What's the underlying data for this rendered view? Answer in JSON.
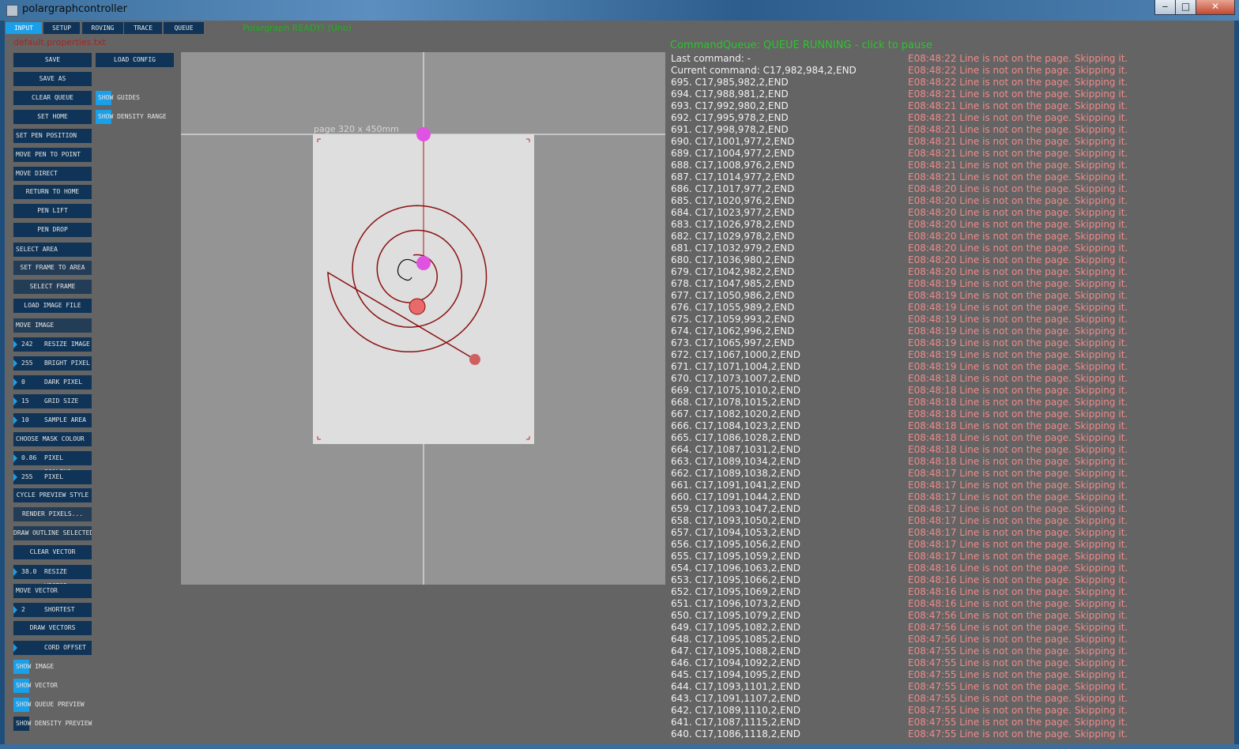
{
  "window": {
    "title": "polargraphcontroller",
    "controls": {
      "minimize": "‒",
      "maximize": "□",
      "close": "✕"
    }
  },
  "tabs": [
    "INPUT",
    "SETUP",
    "ROVING",
    "TRACE",
    "QUEUE"
  ],
  "active_tab": "INPUT",
  "status": "Polargraph READY! (Uno)",
  "properties_file": "default.properties.txt",
  "buttons": {
    "save": "SAVE",
    "load_config": "LOAD CONFIG",
    "save_as": "SAVE AS",
    "clear_queue": "CLEAR QUEUE",
    "set_home": "SET HOME",
    "set_pen_position": "SET PEN POSITION",
    "move_pen_to_point": "MOVE PEN TO POINT",
    "move_direct": "MOVE DIRECT",
    "return_to_home": "RETURN TO HOME",
    "pen_lift": "PEN LIFT",
    "pen_drop": "PEN DROP",
    "select_area": "SELECT AREA",
    "set_frame_to_area": "SET FRAME TO AREA",
    "select_frame": "SELECT FRAME",
    "load_image_file": "LOAD IMAGE FILE",
    "move_image": "MOVE IMAGE",
    "choose_mask_colour": "CHOOSE MASK COLOUR",
    "cycle_preview_style": "CYCLE PREVIEW STYLE",
    "render_pixels": "RENDER PIXELS...",
    "draw_outline_selected": "DRAW OUTLINE SELECTED",
    "clear_vector": "CLEAR VECTOR",
    "move_vector": "MOVE VECTOR",
    "draw_vectors": "DRAW VECTORS"
  },
  "numeric": {
    "resize_image": {
      "value": "242",
      "label": "RESIZE IMAGE"
    },
    "bright_pixel": {
      "value": "255",
      "label": "BRIGHT PIXEL"
    },
    "dark_pixel": {
      "value": "0",
      "label": "DARK PIXEL"
    },
    "grid_size": {
      "value": "15",
      "label": "GRID SIZE"
    },
    "sample_area": {
      "value": "10",
      "label": "SAMPLE AREA"
    },
    "pixel_scaling": {
      "value": "0.86",
      "label": "PIXEL SCALING"
    },
    "pixel_posterize": {
      "value": "255",
      "label": "PIXEL POSTERIZE"
    },
    "resize_vector": {
      "value": "38.0",
      "label": "RESIZE VECTOR"
    },
    "shortest_vector": {
      "value": "2",
      "label": "SHORTEST VECTOR"
    },
    "cord_offset": {
      "value": "",
      "label": "CORD OFFSET"
    }
  },
  "toggles": {
    "show_guides": {
      "label": "SHOW GUIDES",
      "on": true
    },
    "show_density_range": {
      "label": "SHOW DENSITY RANGE",
      "on": true
    },
    "show_image": {
      "label": "SHOW IMAGE",
      "on": true
    },
    "show_vector": {
      "label": "SHOW VECTOR",
      "on": true
    },
    "show_queue_preview": {
      "label": "SHOW QUEUE PREVIEW",
      "on": true
    },
    "show_density_preview": {
      "label": "SHOW DENSITY PREVIEW",
      "on": false
    }
  },
  "canvas": {
    "page_label": "page 320 x 450mm",
    "colors": {
      "background": "#949494",
      "page": "#dedede",
      "spiral": "#8b1010",
      "pen_marker": "#e052e0",
      "queue_marker": "#e86a6a"
    }
  },
  "command_queue": {
    "header": "CommandQueue: QUEUE RUNNING - click to pause",
    "last_command": "Last command: -",
    "current_command": "Current command: C17,982,984,2,END",
    "items": [
      "695. C17,985,982,2,END",
      "694. C17,988,981,2,END",
      "693. C17,992,980,2,END",
      "692. C17,995,978,2,END",
      "691. C17,998,978,2,END",
      "690. C17,1001,977,2,END",
      "689. C17,1004,977,2,END",
      "688. C17,1008,976,2,END",
      "687. C17,1014,977,2,END",
      "686. C17,1017,977,2,END",
      "685. C17,1020,976,2,END",
      "684. C17,1023,977,2,END",
      "683. C17,1026,978,2,END",
      "682. C17,1029,978,2,END",
      "681. C17,1032,979,2,END",
      "680. C17,1036,980,2,END",
      "679. C17,1042,982,2,END",
      "678. C17,1047,985,2,END",
      "677. C17,1050,986,2,END",
      "676. C17,1055,989,2,END",
      "675. C17,1059,993,2,END",
      "674. C17,1062,996,2,END",
      "673. C17,1065,997,2,END",
      "672. C17,1067,1000,2,END",
      "671. C17,1071,1004,2,END",
      "670. C17,1073,1007,2,END",
      "669. C17,1075,1010,2,END",
      "668. C17,1078,1015,2,END",
      "667. C17,1082,1020,2,END",
      "666. C17,1084,1023,2,END",
      "665. C17,1086,1028,2,END",
      "664. C17,1087,1031,2,END",
      "663. C17,1089,1034,2,END",
      "662. C17,1089,1038,2,END",
      "661. C17,1091,1041,2,END",
      "660. C17,1091,1044,2,END",
      "659. C17,1093,1047,2,END",
      "658. C17,1093,1050,2,END",
      "657. C17,1094,1053,2,END",
      "656. C17,1095,1056,2,END",
      "655. C17,1095,1059,2,END",
      "654. C17,1096,1063,2,END",
      "653. C17,1095,1066,2,END",
      "652. C17,1095,1069,2,END",
      "651. C17,1096,1073,2,END",
      "650. C17,1095,1079,2,END",
      "649. C17,1095,1082,2,END",
      "648. C17,1095,1085,2,END",
      "647. C17,1095,1088,2,END",
      "646. C17,1094,1092,2,END",
      "645. C17,1094,1095,2,END",
      "644. C17,1093,1101,2,END",
      "643. C17,1091,1107,2,END",
      "642. C17,1089,1110,2,END",
      "641. C17,1087,1115,2,END",
      "640. C17,1086,1118,2,END"
    ]
  },
  "log_messages": [
    "E08:48:22 Line is not on the page. Skipping it.",
    "E08:48:22 Line is not on the page. Skipping it.",
    "E08:48:22 Line is not on the page. Skipping it.",
    "E08:48:21 Line is not on the page. Skipping it.",
    "E08:48:21 Line is not on the page. Skipping it.",
    "E08:48:21 Line is not on the page. Skipping it.",
    "E08:48:21 Line is not on the page. Skipping it.",
    "E08:48:21 Line is not on the page. Skipping it.",
    "E08:48:21 Line is not on the page. Skipping it.",
    "E08:48:21 Line is not on the page. Skipping it.",
    "E08:48:21 Line is not on the page. Skipping it.",
    "E08:48:20 Line is not on the page. Skipping it.",
    "E08:48:20 Line is not on the page. Skipping it.",
    "E08:48:20 Line is not on the page. Skipping it.",
    "E08:48:20 Line is not on the page. Skipping it.",
    "E08:48:20 Line is not on the page. Skipping it.",
    "E08:48:20 Line is not on the page. Skipping it.",
    "E08:48:20 Line is not on the page. Skipping it.",
    "E08:48:20 Line is not on the page. Skipping it.",
    "E08:48:19 Line is not on the page. Skipping it.",
    "E08:48:19 Line is not on the page. Skipping it.",
    "E08:48:19 Line is not on the page. Skipping it.",
    "E08:48:19 Line is not on the page. Skipping it.",
    "E08:48:19 Line is not on the page. Skipping it.",
    "E08:48:19 Line is not on the page. Skipping it.",
    "E08:48:19 Line is not on the page. Skipping it.",
    "E08:48:19 Line is not on the page. Skipping it.",
    "E08:48:18 Line is not on the page. Skipping it.",
    "E08:48:18 Line is not on the page. Skipping it.",
    "E08:48:18 Line is not on the page. Skipping it.",
    "E08:48:18 Line is not on the page. Skipping it.",
    "E08:48:18 Line is not on the page. Skipping it.",
    "E08:48:18 Line is not on the page. Skipping it.",
    "E08:48:18 Line is not on the page. Skipping it.",
    "E08:48:18 Line is not on the page. Skipping it.",
    "E08:48:17 Line is not on the page. Skipping it.",
    "E08:48:17 Line is not on the page. Skipping it.",
    "E08:48:17 Line is not on the page. Skipping it.",
    "E08:48:17 Line is not on the page. Skipping it.",
    "E08:48:17 Line is not on the page. Skipping it.",
    "E08:48:17 Line is not on the page. Skipping it.",
    "E08:48:17 Line is not on the page. Skipping it.",
    "E08:48:17 Line is not on the page. Skipping it.",
    "E08:48:16 Line is not on the page. Skipping it.",
    "E08:48:16 Line is not on the page. Skipping it.",
    "E08:48:16 Line is not on the page. Skipping it.",
    "E08:48:16 Line is not on the page. Skipping it.",
    "E08:47:56 Line is not on the page. Skipping it.",
    "E08:47:56 Line is not on the page. Skipping it.",
    "E08:47:56 Line is not on the page. Skipping it.",
    "E08:47:55 Line is not on the page. Skipping it.",
    "E08:47:55 Line is not on the page. Skipping it.",
    "E08:47:55 Line is not on the page. Skipping it.",
    "E08:47:55 Line is not on the page. Skipping it.",
    "E08:47:55 Line is not on the page. Skipping it.",
    "E08:47:55 Line is not on the page. Skipping it.",
    "E08:47:55 Line is not on the page. Skipping it.",
    "E08:47:55 Line is not on the page. Skipping it."
  ]
}
